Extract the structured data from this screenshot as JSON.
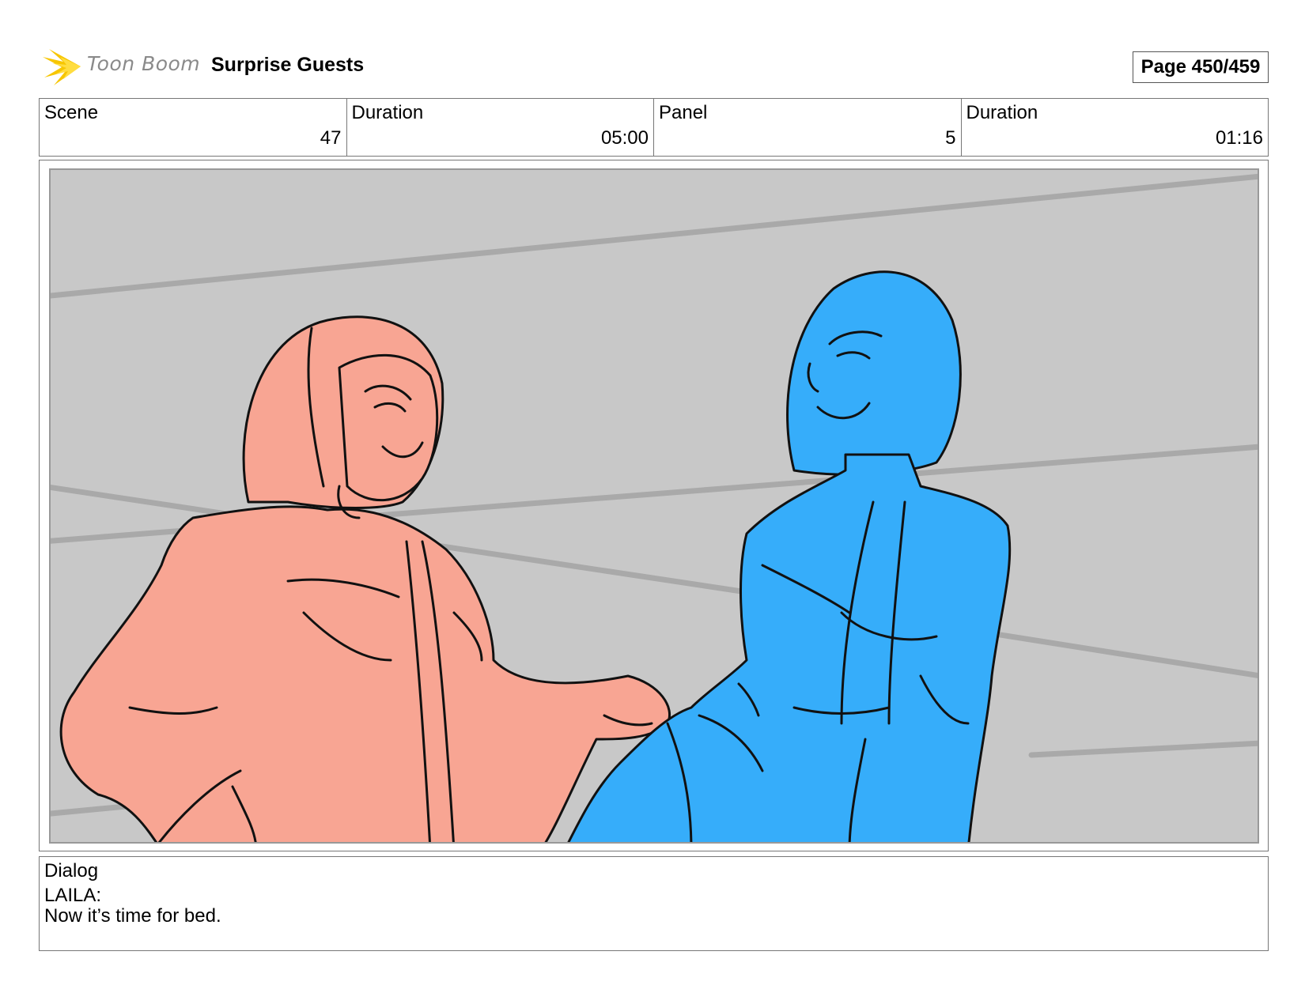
{
  "header": {
    "logo_text": "Toon Boom",
    "title": "Surprise Guests",
    "page_label": "Page 450/459"
  },
  "info": {
    "scene_label": "Scene",
    "scene_value": "47",
    "scene_duration_label": "Duration",
    "scene_duration_value": "05:00",
    "panel_label": "Panel",
    "panel_value": "5",
    "panel_duration_label": "Duration",
    "panel_duration_value": "01:16"
  },
  "panel": {
    "background_color": "#c8c8c8",
    "left_character_color": "#f8a593",
    "right_character_color": "#36adfa"
  },
  "dialog": {
    "label": "Dialog",
    "speaker": "LAILA:",
    "line": "Now it’s time for bed."
  },
  "colors": {
    "logo_yellow": "#f7c600",
    "border_gray": "#777777"
  }
}
